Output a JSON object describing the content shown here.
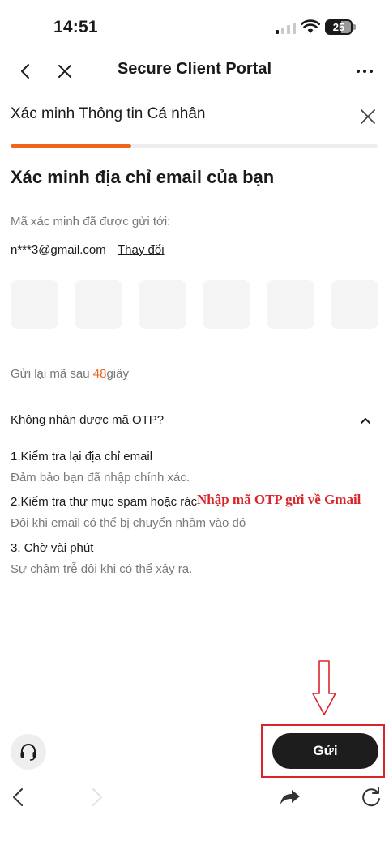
{
  "status_bar": {
    "time": "14:51",
    "battery": "25",
    "signal_bars_filled": 1,
    "signal_bars_total": 4
  },
  "nav": {
    "title": "Secure Client Portal"
  },
  "dialog": {
    "title": "Xác minh Thông tin Cá nhân",
    "progress_fraction": 0.33
  },
  "verify": {
    "heading": "Xác minh địa chỉ email của bạn",
    "sent_label": "Mã xác minh đã được gửi tới:",
    "email": "n***3@gmail.com",
    "change_link": "Thay đổi",
    "otp_box_count": 6,
    "resend_prefix": "Gửi lại mã sau ",
    "resend_seconds": "48",
    "resend_suffix": "giây"
  },
  "faq": {
    "question": "Không nhận được mã OTP?",
    "tips": [
      {
        "title": "1.Kiểm tra lại địa chỉ email",
        "desc": "Đảm bảo bạn đã nhập chính xác."
      },
      {
        "title": "2.Kiểm tra thư mục spam hoặc rác",
        "desc": "Đôi khi email có thể bị chuyển nhầm vào đó"
      },
      {
        "title": "3. Chờ vài phút",
        "desc": "Sự chậm trễ đôi khi có thể xảy ra."
      }
    ]
  },
  "annotation": {
    "text": "Nhập mã OTP gửi về Gmail",
    "color": "#d8252b"
  },
  "footer": {
    "send_label": "Gửi"
  },
  "colors": {
    "accent": "#f0641e",
    "button": "#1d1d1d"
  },
  "icons": [
    "back-chevron-icon",
    "close-icon",
    "more-icon",
    "headset-icon",
    "share-icon",
    "reload-icon",
    "chevron-up-icon",
    "down-arrow-icon"
  ]
}
